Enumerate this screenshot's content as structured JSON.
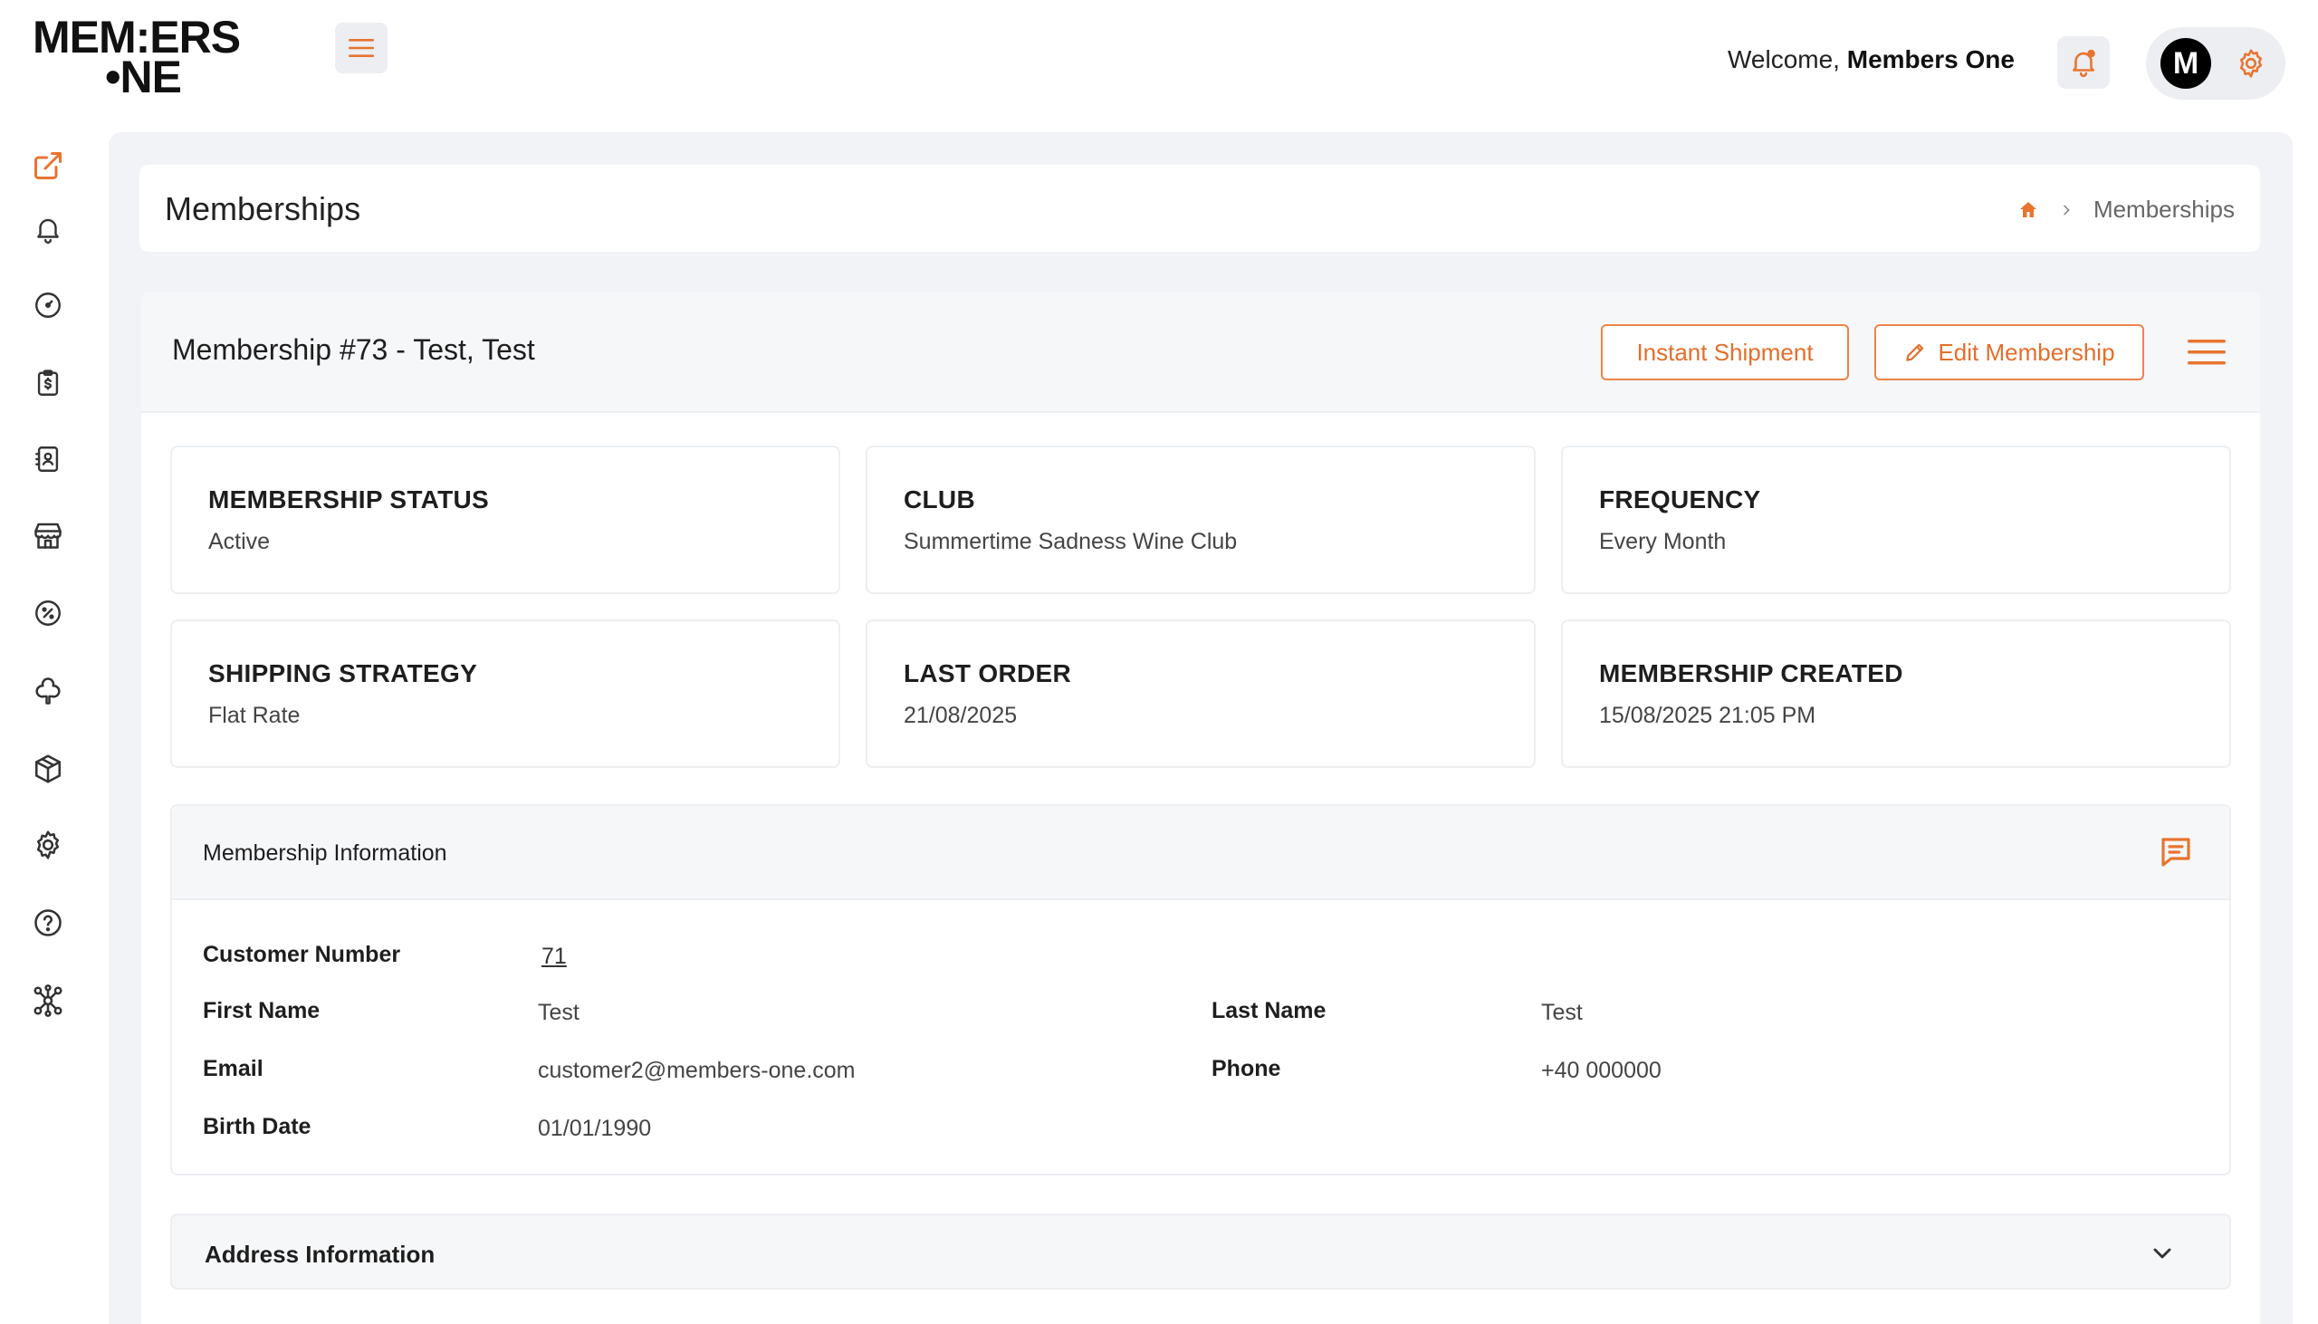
{
  "app": {
    "logo_line1": "MEM:ERS",
    "logo_line2": "•NE",
    "accent_color": "#e8742f"
  },
  "header": {
    "welcome_prefix": "Welcome,",
    "user_name": "Members One",
    "avatar_letter": "M"
  },
  "sidebar": {
    "items": [
      {
        "icon": "external-link-icon"
      },
      {
        "icon": "bell-icon"
      },
      {
        "icon": "dashboard-icon"
      },
      {
        "icon": "clipboard-dollar-icon"
      },
      {
        "icon": "contacts-icon"
      },
      {
        "icon": "store-icon"
      },
      {
        "icon": "discount-icon"
      },
      {
        "icon": "club-icon"
      },
      {
        "icon": "package-icon"
      },
      {
        "icon": "settings-icon"
      },
      {
        "icon": "help-icon"
      },
      {
        "icon": "integrations-icon"
      }
    ]
  },
  "page": {
    "title": "Memberships",
    "breadcrumb": [
      "Memberships"
    ]
  },
  "membership": {
    "title": "Membership #73 - Test, Test",
    "instant_shipment_label": "Instant Shipment",
    "edit_label": "Edit Membership"
  },
  "stats": [
    {
      "label": "MEMBERSHIP STATUS",
      "value": "Active"
    },
    {
      "label": "CLUB",
      "value": "Summertime Sadness Wine Club"
    },
    {
      "label": "FREQUENCY",
      "value": "Every Month"
    },
    {
      "label": "SHIPPING STRATEGY",
      "value": "Flat Rate"
    },
    {
      "label": "LAST ORDER",
      "value": "21/08/2025"
    },
    {
      "label": "MEMBERSHIP CREATED",
      "value": "15/08/2025 21:05 PM"
    }
  ],
  "info": {
    "title": "Membership Information",
    "customer_number_label": "Customer Number",
    "customer_number": "71",
    "first_name_label": "First Name",
    "first_name": "Test",
    "last_name_label": "Last Name",
    "last_name": "Test",
    "email_label": "Email",
    "email": "customer2@members-one.com",
    "phone_label": "Phone",
    "phone": "+40 000000",
    "birth_date_label": "Birth Date",
    "birth_date": "01/01/1990"
  },
  "address": {
    "title": "Address Information"
  }
}
